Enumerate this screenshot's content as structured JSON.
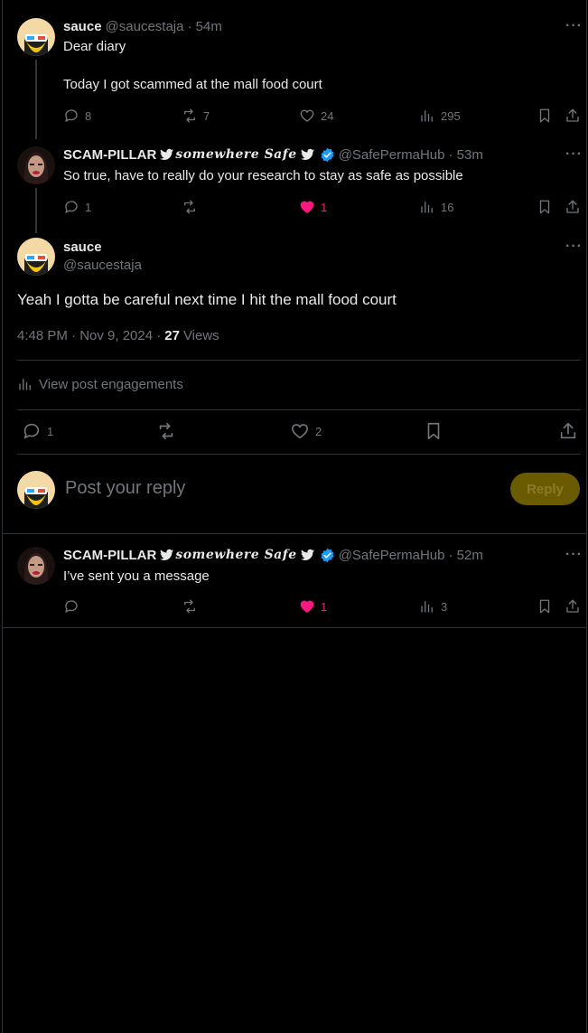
{
  "colors": {
    "background": "#000000",
    "text": "#e7e9ea",
    "muted": "#71767b",
    "like": "#f91880",
    "verified": "#1d9bf0",
    "reply_button": "#6b5b00"
  },
  "post1": {
    "name": "sauce",
    "handle": "@saucestaja",
    "time": "· 54m",
    "line1": "Dear diary",
    "line2": "Today I got scammed at the mall food court",
    "replies": "8",
    "reposts": "7",
    "likes": "24",
    "views": "295"
  },
  "post2": {
    "name": "SCAM-PILLAR",
    "name_fancy": "somewhere Safe",
    "handle": "@SafePermaHub",
    "time": "· 53m",
    "text": "So true, have to really do your research to stay as safe as possible",
    "replies": "1",
    "likes": "1",
    "views": "16"
  },
  "main": {
    "name": "sauce",
    "handle": "@saucestaja",
    "text": "Yeah I gotta be careful next time I hit the mall food court",
    "timestamp": "4:48 PM · Nov 9, 2024 ·",
    "views_count": "27",
    "views_label": "Views",
    "engagements": "View post engagements",
    "replies": "1",
    "likes": "2"
  },
  "composer": {
    "placeholder": "Post your reply",
    "button": "Reply"
  },
  "post3": {
    "name": "SCAM-PILLAR",
    "name_fancy": "somewhere Safe",
    "handle": "@SafePermaHub",
    "time": "· 52m",
    "text": "I’ve sent you a message",
    "likes": "1",
    "views": "3"
  }
}
